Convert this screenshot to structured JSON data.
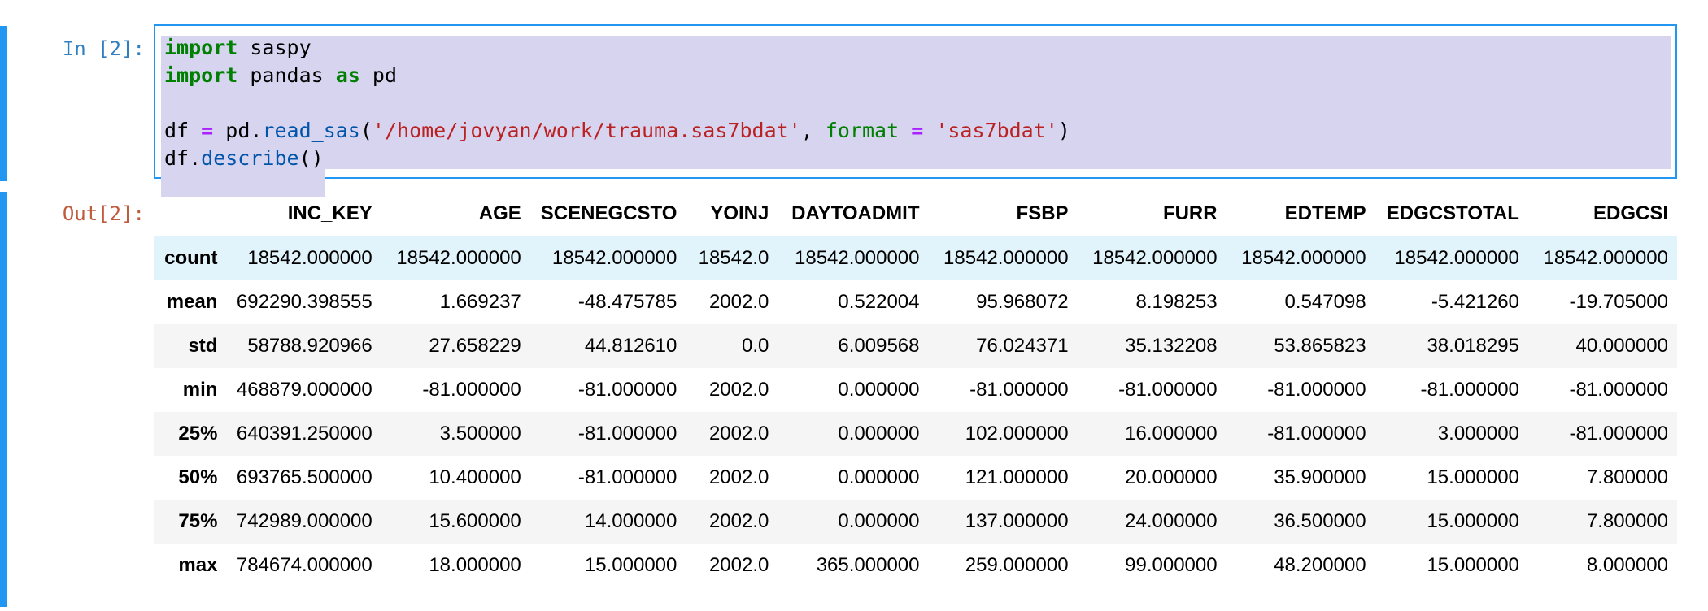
{
  "notebook": {
    "input_prompt": "In [2]:",
    "output_prompt": "Out[2]:",
    "code_tokens": [
      [
        {
          "t": "import",
          "c": "kw"
        },
        {
          "t": " saspy",
          "c": ""
        }
      ],
      [
        {
          "t": "import",
          "c": "kw"
        },
        {
          "t": " pandas ",
          "c": ""
        },
        {
          "t": "as",
          "c": "kw"
        },
        {
          "t": " pd",
          "c": ""
        }
      ],
      [],
      [
        {
          "t": "df ",
          "c": ""
        },
        {
          "t": "=",
          "c": "op"
        },
        {
          "t": " pd.",
          "c": ""
        },
        {
          "t": "read_sas",
          "c": "fn"
        },
        {
          "t": "(",
          "c": ""
        },
        {
          "t": "'/home/jovyan/work/trauma.sas7bdat'",
          "c": "str"
        },
        {
          "t": ", ",
          "c": ""
        },
        {
          "t": "format",
          "c": "kw-plain"
        },
        {
          "t": " ",
          "c": ""
        },
        {
          "t": "=",
          "c": "op"
        },
        {
          "t": " ",
          "c": ""
        },
        {
          "t": "'sas7bdat'",
          "c": "str"
        },
        {
          "t": ")",
          "c": ""
        }
      ],
      [
        {
          "t": "df.",
          "c": ""
        },
        {
          "t": "describe",
          "c": "fn"
        },
        {
          "t": "()",
          "c": ""
        }
      ]
    ]
  },
  "colors": {
    "cell_bar": "#2196f3",
    "prompt_in": "#307fc1",
    "prompt_out": "#bf5b3d",
    "selection": "#d7d4f0",
    "hover_row": "#e1f3fb"
  },
  "table": {
    "columns": [
      "INC_KEY",
      "AGE",
      "SCENEGCSTO",
      "YOINJ",
      "DAYTOADMIT",
      "FSBP",
      "FURR",
      "EDTEMP",
      "EDGCSTOTAL",
      "EDGCSI"
    ],
    "rows": [
      {
        "label": "count",
        "values": [
          "18542.000000",
          "18542.000000",
          "18542.000000",
          "18542.0",
          "18542.000000",
          "18542.000000",
          "18542.000000",
          "18542.000000",
          "18542.000000",
          "18542.000000"
        ]
      },
      {
        "label": "mean",
        "values": [
          "692290.398555",
          "1.669237",
          "-48.475785",
          "2002.0",
          "0.522004",
          "95.968072",
          "8.198253",
          "0.547098",
          "-5.421260",
          "-19.705000"
        ]
      },
      {
        "label": "std",
        "values": [
          "58788.920966",
          "27.658229",
          "44.812610",
          "0.0",
          "6.009568",
          "76.024371",
          "35.132208",
          "53.865823",
          "38.018295",
          "40.000000"
        ]
      },
      {
        "label": "min",
        "values": [
          "468879.000000",
          "-81.000000",
          "-81.000000",
          "2002.0",
          "0.000000",
          "-81.000000",
          "-81.000000",
          "-81.000000",
          "-81.000000",
          "-81.000000"
        ]
      },
      {
        "label": "25%",
        "values": [
          "640391.250000",
          "3.500000",
          "-81.000000",
          "2002.0",
          "0.000000",
          "102.000000",
          "16.000000",
          "-81.000000",
          "3.000000",
          "-81.000000"
        ]
      },
      {
        "label": "50%",
        "values": [
          "693765.500000",
          "10.400000",
          "-81.000000",
          "2002.0",
          "0.000000",
          "121.000000",
          "20.000000",
          "35.900000",
          "15.000000",
          "7.800000"
        ]
      },
      {
        "label": "75%",
        "values": [
          "742989.000000",
          "15.600000",
          "14.000000",
          "2002.0",
          "0.000000",
          "137.000000",
          "24.000000",
          "36.500000",
          "15.000000",
          "7.800000"
        ]
      },
      {
        "label": "max",
        "values": [
          "784674.000000",
          "18.000000",
          "15.000000",
          "2002.0",
          "365.000000",
          "259.000000",
          "99.000000",
          "48.200000",
          "15.000000",
          "8.000000"
        ]
      }
    ]
  }
}
